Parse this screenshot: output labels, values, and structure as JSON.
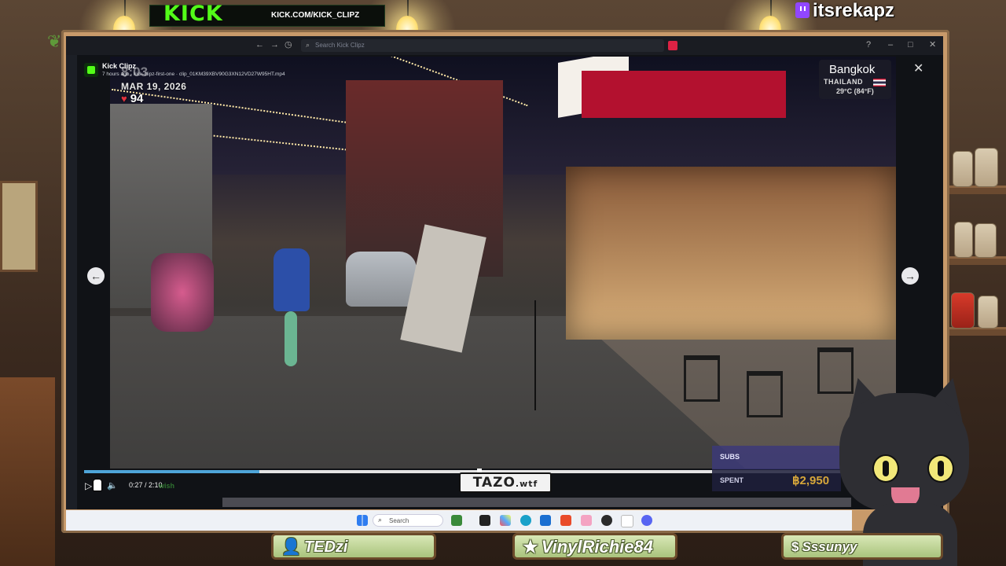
{
  "branding": {
    "kick_logo": "KICK",
    "kick_url": "KICK.COM/KICK_CLIPZ",
    "twitch_handle": "itsrekapz"
  },
  "browser": {
    "search_placeholder": "Search Kick Clipz",
    "nav_back_icon": "arrow-left-icon",
    "nav_forward_icon": "arrow-right-icon",
    "window_controls": [
      "help-icon",
      "minimize-icon",
      "maximize-icon",
      "close-icon"
    ]
  },
  "video": {
    "channel_name": "Kick Clipz",
    "meta_line": "7 hours ago · kick-clipz-first-one · clip_01KM39XBV90G3XN12VD27W95HT.mp4",
    "ghost_time": "8:03",
    "date": "MAR 19, 2026",
    "likes": "94",
    "location": {
      "city": "Bangkok",
      "country": "THAILAND",
      "temperature": "29°C (84°F)"
    },
    "close_label": "✕",
    "prev_label": "←",
    "next_label": "→"
  },
  "player": {
    "play_icon": "play-icon",
    "volume_icon": "volume-icon",
    "time": "0:27 / 2:10",
    "progress": 0.223,
    "ghost_text": "wish"
  },
  "watermark": {
    "text": "TAZO",
    "suffix": ".wtf"
  },
  "stats": {
    "subs_label": "SUBS",
    "spent_label": "SPENT",
    "spent_value": "฿2,950"
  },
  "taskbar": {
    "search_label": "Search",
    "icons": [
      "windows-icon",
      "search-icon",
      "widgets-icon",
      "file-explorer-icon",
      "photos-icon",
      "edge-icon",
      "store-icon",
      "brave-icon",
      "paint-icon",
      "obs-icon",
      "notepad-icon",
      "discord-icon"
    ]
  },
  "nameplates": [
    {
      "icon": "person-icon",
      "symbol": "👤",
      "name": "TEDzi"
    },
    {
      "icon": "star-icon",
      "symbol": "★",
      "name": "VinylRichie84"
    },
    {
      "icon": "dollar-icon",
      "symbol": "$",
      "name": "Sssunyy"
    }
  ]
}
